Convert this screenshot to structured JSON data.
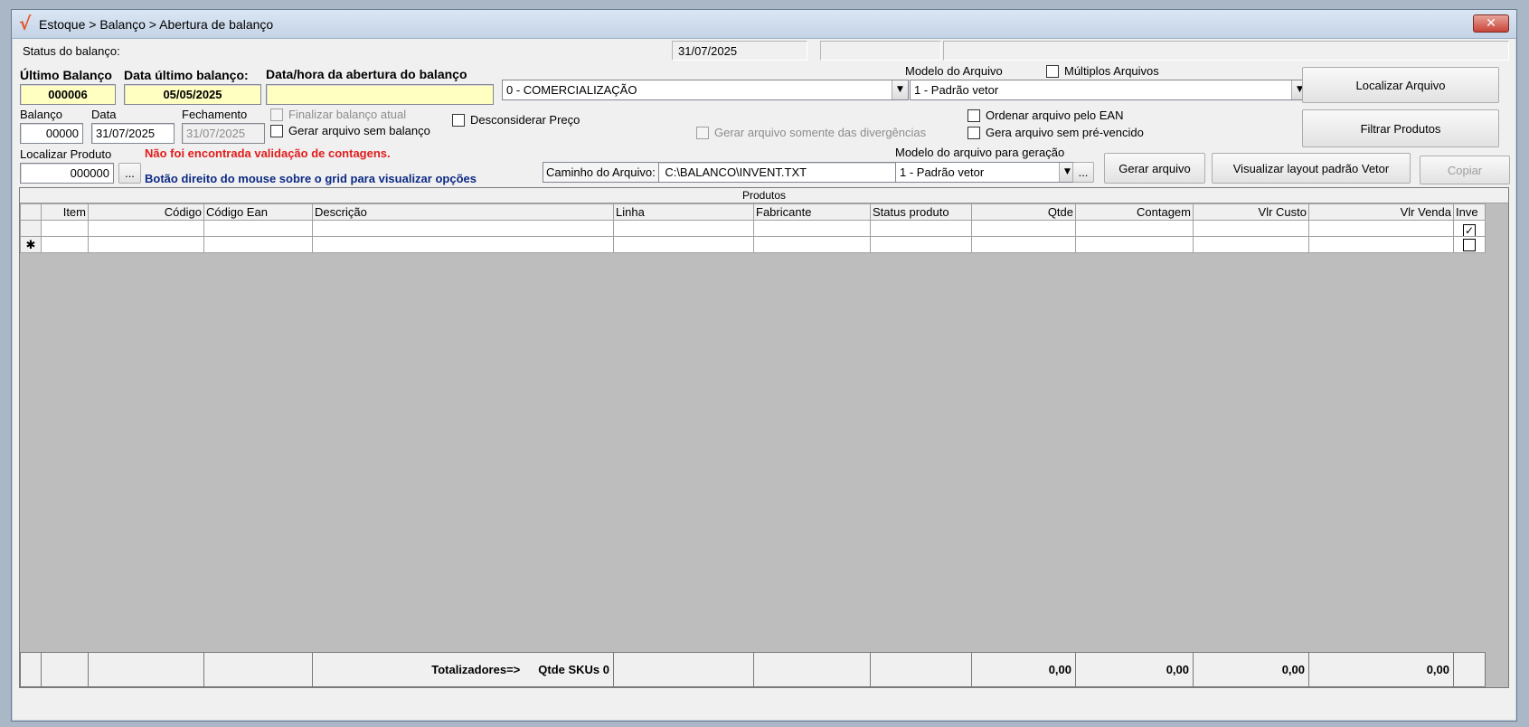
{
  "window": {
    "title": "Estoque > Balanço > Abertura de balanço",
    "close_label": "✕"
  },
  "status": {
    "label": "Status do balanço:",
    "date": "31/07/2025",
    "cell2": "",
    "cell3": ""
  },
  "header": {
    "ultimo_balanco_label": "Último Balanço",
    "ultimo_balanco_value": "000006",
    "data_ultimo_label": "Data último balanço:",
    "data_ultimo_value": "05/05/2025",
    "abertura_label": "Data/hora da abertura do balanço",
    "abertura_value": "",
    "tipo_combo": "0 - COMERCIALIZAÇÃO",
    "modelo_arquivo_label": "Modelo do Arquivo",
    "modelo_arquivo_value": "1 - Padrão vetor",
    "multiplos_label": "Múltiplos Arquivos"
  },
  "row2": {
    "balanco_label": "Balanço",
    "balanco_value": "00000",
    "data_label": "Data",
    "data_value": "31/07/2025",
    "fechamento_label": "Fechamento",
    "fechamento_value": "31/07/2025",
    "finalizar_label": "Finalizar balanço atual",
    "gerar_sem_balanco_label": "Gerar arquivo sem balanço",
    "desconsiderar_label": "Desconsiderar Preço",
    "divergencias_label": "Gerar arquivo somente das divergências",
    "ordenar_ean_label": "Ordenar arquivo pelo EAN",
    "sem_prevencido_label": "Gera arquivo sem pré-vencido"
  },
  "row3": {
    "localizar_label": "Localizar Produto",
    "localizar_value": "000000",
    "ellipsis": "...",
    "warning": "Não foi encontrada validação de contagens.",
    "hint": "Botão direito do mouse sobre o grid para visualizar opções",
    "caminho_label": "Caminho do Arquivo:",
    "caminho_value": "C:\\BALANCO\\INVENT.TXT",
    "modelo_geracao_label": "Modelo do arquivo para geração",
    "modelo_geracao_value": "1 - Padrão vetor"
  },
  "buttons": {
    "localizar_arquivo": "Localizar Arquivo",
    "filtrar_produtos": "Filtrar Produtos",
    "gerar_arquivo": "Gerar arquivo",
    "visualizar_layout": "Visualizar layout padrão Vetor",
    "copiar": "Copiar"
  },
  "grid": {
    "caption": "Produtos",
    "columns": [
      "Item",
      "Código",
      "Código Ean",
      "Descrição",
      "Linha",
      "Fabricante",
      "Status produto",
      "Qtde",
      "Contagem",
      "Vlr Custo",
      "Vlr Venda",
      "Inve"
    ],
    "new_row_marker": "✱",
    "row1_check": "✓"
  },
  "totals": {
    "label": "Totalizadores=>",
    "skus": "Qtde SKUs 0",
    "qtde": "0,00",
    "contagem": "0,00",
    "custo": "0,00",
    "venda": "0,00"
  }
}
